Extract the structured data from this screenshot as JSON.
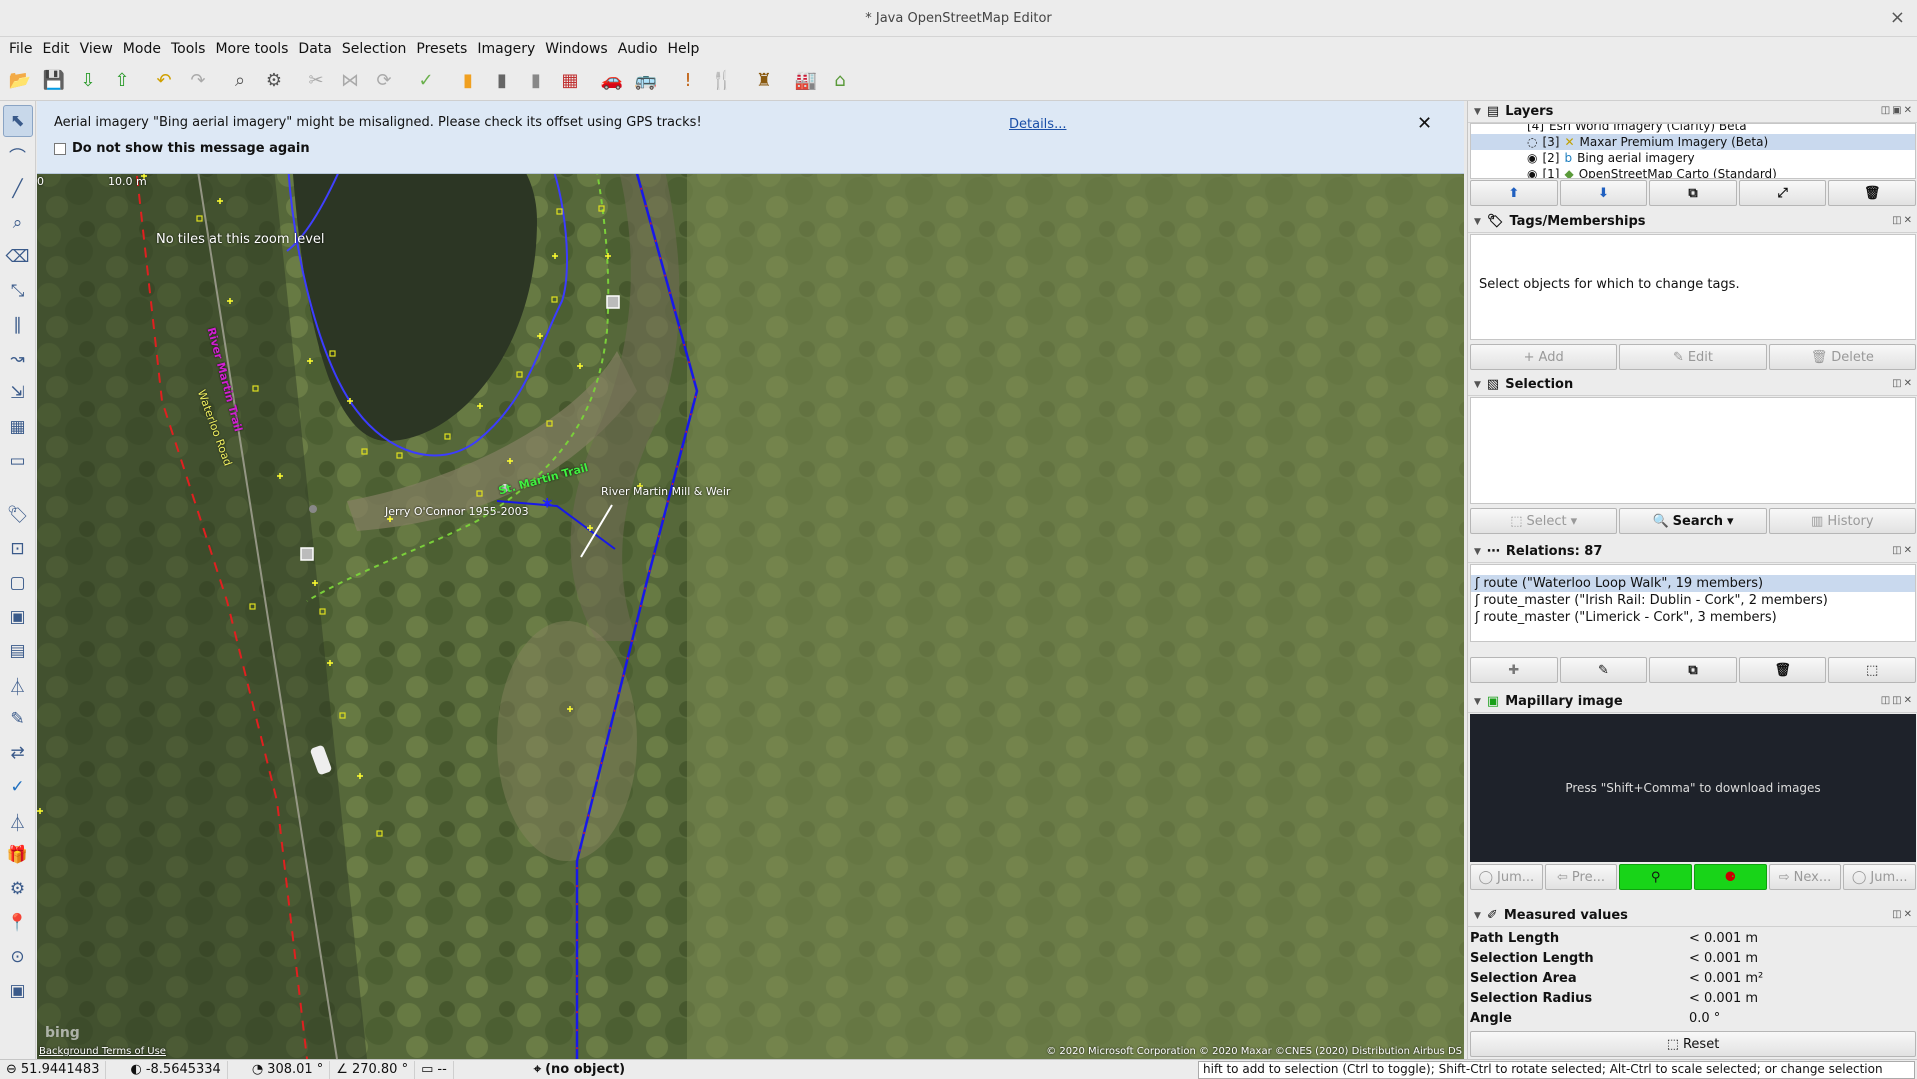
{
  "window": {
    "title": "* Java OpenStreetMap Editor",
    "close": "×"
  },
  "menu": [
    "File",
    "Edit",
    "View",
    "Mode",
    "Tools",
    "More tools",
    "Data",
    "Selection",
    "Presets",
    "Imagery",
    "Windows",
    "Audio",
    "Help"
  ],
  "toolbar_icons": [
    "open-icon",
    "save-icon",
    "download-icon",
    "upload-icon",
    "undo-icon",
    "redo-icon",
    "zoom-data-icon",
    "preferences-icon",
    "split-way-icon",
    "combine-way-icon",
    "refresh-icon",
    "validator-icon",
    "highway-primary-icon",
    "highway-secondary-icon",
    "highway-tertiary-icon",
    "railway-icon",
    "car-icon",
    "bus-icon",
    "warning-icon",
    "restaurant-icon",
    "castle-icon",
    "industry-icon",
    "building-icon"
  ],
  "left_tools": [
    "select-icon",
    "lasso-icon",
    "draw-icon",
    "zoom-icon",
    "delete-icon",
    "improve-way-icon",
    "parallel-icon",
    "follow-icon",
    "extrude-icon",
    "building-tool-icon",
    "layer-icon",
    "tag-icon",
    "relation-editor-icon",
    "area-icon",
    "photo-icon",
    "image-icon",
    "filter-icon",
    "map-icon",
    "wireframe-icon",
    "check-icon",
    "filter2-icon",
    "gift-icon",
    "mapillary-icon",
    "notes-icon",
    "conflict-icon",
    "export-icon"
  ],
  "notice": {
    "message": "Aerial imagery \"Bing aerial imagery\" might be misaligned. Please check its offset using GPS tracks!",
    "checkbox": "Do not show this message again",
    "details": "Details...",
    "close": "✕"
  },
  "map": {
    "scale": {
      "zero": "0",
      "label": "10.0 m"
    },
    "no_tiles": "No tiles at this zoom level",
    "labels": {
      "river_martin_trail": "River Martin Trail",
      "waterloo_road": "Waterloo Road",
      "jerry": "Jerry O'Connor 1955-2003",
      "martin_trail": "St. Martin Trail",
      "mill": "River Martin Mill & Weir"
    },
    "bing": "bing",
    "terms": "Background Terms of Use",
    "attribution": "© 2020 Microsoft Corporation © 2020 Maxar ©CNES (2020) Distribution Airbus DS"
  },
  "layers_panel": {
    "title": "Layers",
    "items": [
      {
        "num": "[4]",
        "name": "Esri World Imagery (Clarity) Beta"
      },
      {
        "num": "[3]",
        "name": "Maxar Premium Imagery (Beta)"
      },
      {
        "num": "[2]",
        "name": "Bing aerial imagery"
      },
      {
        "num": "[1]",
        "name": "OpenStreetMap Carto (Standard)"
      }
    ]
  },
  "tags_panel": {
    "title": "Tags/Memberships",
    "empty": "Select objects for which to change tags.",
    "add": "Add",
    "edit": "Edit",
    "delete": "Delete"
  },
  "selection_panel": {
    "title": "Selection",
    "select": "Select",
    "search": "Search",
    "history": "History"
  },
  "relations_panel": {
    "title": "Relations: 87",
    "items": [
      "route (\"Waterloo Loop Walk\", 19 members)",
      "route_master (\"Irish Rail: Dublin - Cork\", 2 members)",
      "route_master (\"Limerick - Cork\", 3 members)"
    ]
  },
  "mapillary_panel": {
    "title": "Mapillary image",
    "message": "Press \"Shift+Comma\" to download images",
    "jump_prev": "Jum...",
    "prev": "Pre...",
    "next": "Nex...",
    "jump_next": "Jum..."
  },
  "measured_panel": {
    "title": "Measured values",
    "rows": [
      {
        "k": "Path Length",
        "v": "< 0.001 m"
      },
      {
        "k": "Selection Length",
        "v": "< 0.001 m"
      },
      {
        "k": "Selection Area",
        "v": "< 0.001 m²"
      },
      {
        "k": "Selection Radius",
        "v": "< 0.001 m"
      },
      {
        "k": "Angle",
        "v": "0.0 °"
      }
    ],
    "reset": "Reset"
  },
  "status": {
    "lat": "51.9441483",
    "lon": "-8.5645334",
    "heading": "308.01 °",
    "angle": "270.80 °",
    "dist": "--",
    "object": "(no object)",
    "help": "hift to add to selection (Ctrl to toggle); Shift-Ctrl to rotate selected; Alt-Ctrl to scale selected; or change selection"
  },
  "colors": {
    "selection_blue": "#c9d9ee",
    "notice_bg": "#dde8f5",
    "mapillary_green": "#18d418"
  }
}
